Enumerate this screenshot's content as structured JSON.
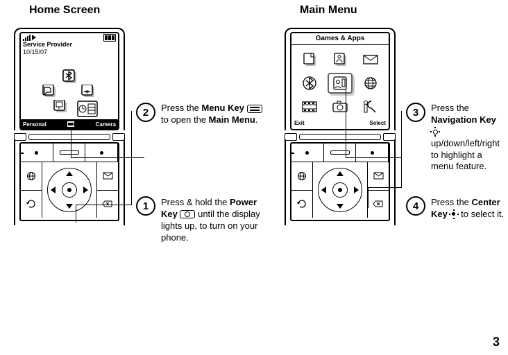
{
  "page_number": "3",
  "titles": {
    "left": "Home Screen",
    "right": "Main Menu"
  },
  "home": {
    "provider": "Service Provider",
    "date": "10/15/07",
    "soft_left": "Personal",
    "soft_right": "Camera",
    "icons": {
      "bluetooth": "bluetooth-icon",
      "talk": "talk-icon",
      "signal2": "wifi-icon",
      "apps": "apps-icon",
      "clock": "clock-icon"
    }
  },
  "mainmenu": {
    "title": "Games & Apps",
    "soft_left": "Exit",
    "soft_right": "Select",
    "icons": [
      "file-icon",
      "addressbook-icon",
      "envelope-icon",
      "bluetooth-icon",
      "phonebook-icon",
      "globe-icon",
      "film-icon",
      "camera-icon",
      "tools-icon"
    ],
    "selected_index": 4
  },
  "callouts": {
    "c1_a": "Press & hold the ",
    "c1_b": "Power Key",
    "c1_c": " until the display lights up, to turn on your phone.",
    "c2_a": "Press the ",
    "c2_b": "Menu Key",
    "c2_c": " to open the ",
    "c2_d": "Main Menu",
    "c2_e": ".",
    "c3_a": "Press the ",
    "c3_b": "Navigation Key",
    "c3_c": " up/down/left/right to highlight a menu feature.",
    "c4_a": "Press the ",
    "c4_b": "Center Key",
    "c4_c": " to select it."
  },
  "nums": {
    "one": "1",
    "two": "2",
    "three": "3",
    "four": "4"
  }
}
